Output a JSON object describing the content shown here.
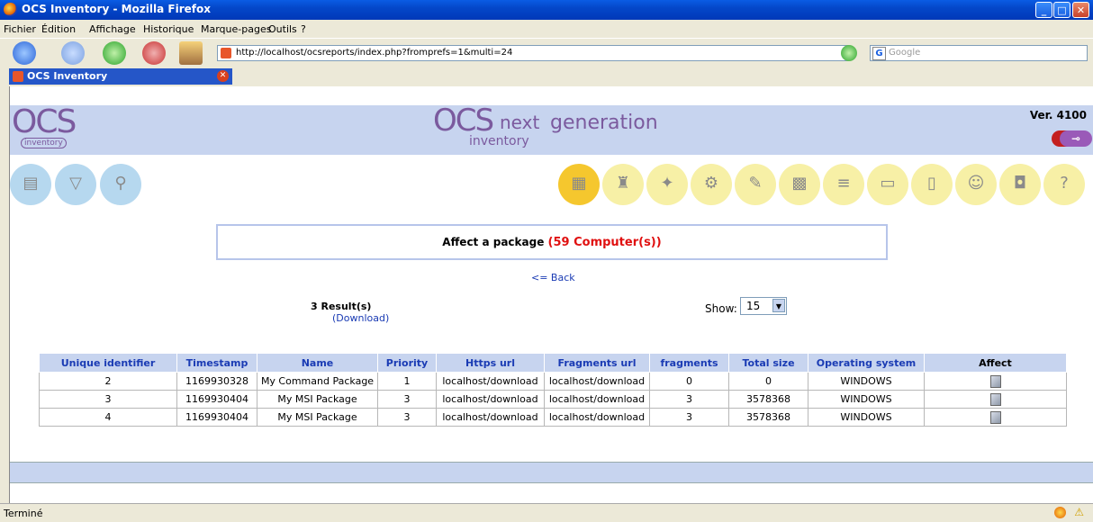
{
  "window": {
    "title": "OCS Inventory - Mozilla Firefox"
  },
  "menu": {
    "items": [
      "Fichier",
      "Édition",
      "Affichage",
      "Historique",
      "Marque-pages",
      "Outils",
      "?"
    ]
  },
  "nav": {
    "url": "http://localhost/ocsreports/index.php?fromprefs=1&multi=24",
    "search_placeholder": "Google"
  },
  "tab": {
    "label": "OCS Inventory"
  },
  "header": {
    "logo_left": "OCS",
    "logo_left_sub": "inventory",
    "logo_center_big": "OCS",
    "logo_center_next": "next",
    "logo_center_sub": "inventory",
    "logo_center_gen": "generation",
    "version": "Ver. 4100"
  },
  "page": {
    "title_prefix": "Affect a package",
    "title_count": "(59 Computer(s))",
    "back_link": "<= Back",
    "results": "3 Result(s)",
    "download": "(Download)",
    "show_label": "Show:",
    "show_value": "15"
  },
  "table": {
    "headers": [
      "Unique identifier",
      "Timestamp",
      "Name",
      "Priority",
      "Https url",
      "Fragments url",
      "fragments",
      "Total size",
      "Operating system",
      "Affect"
    ],
    "rows": [
      [
        "2",
        "1169930328",
        "My Command Package",
        "1",
        "localhost/download",
        "localhost/download",
        "0",
        "0",
        "WINDOWS"
      ],
      [
        "3",
        "1169930404",
        "My MSI Package",
        "3",
        "localhost/download",
        "localhost/download",
        "3",
        "3578368",
        "WINDOWS"
      ],
      [
        "4",
        "1169930404",
        "My MSI Package",
        "3",
        "localhost/download",
        "localhost/download",
        "3",
        "3578368",
        "WINDOWS"
      ]
    ]
  },
  "status": {
    "text": "Terminé"
  },
  "colors": {
    "header_bg": "#c7d4ef",
    "link": "#1a3bb4",
    "count_red": "#e01010",
    "icon_yellow": "#f7f0a6",
    "icon_blue": "#b6d8ef"
  }
}
